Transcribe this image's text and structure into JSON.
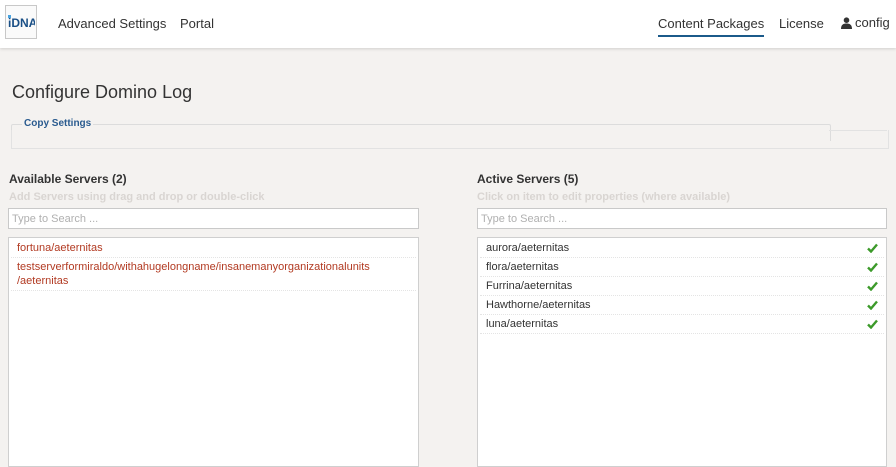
{
  "header": {
    "logo_text": "iDNA",
    "nav_left": [
      {
        "label": "Advanced Settings"
      },
      {
        "label": "Portal"
      }
    ],
    "nav_right": [
      {
        "label": "Content Packages",
        "active": true
      },
      {
        "label": "License"
      }
    ],
    "user": {
      "label": "config",
      "icon": "user-icon"
    }
  },
  "page": {
    "title": "Configure Domino Log",
    "fieldset_legend": "Copy Settings"
  },
  "available": {
    "title": "Available Servers (2)",
    "hint": "Add Servers using drag and drop or double-click",
    "search_placeholder": "Type to Search ...",
    "items": [
      {
        "label": "fortuna/aeternitas"
      },
      {
        "label": "testserverformiraldo/withahugelongname/insanemanyorganizationalunits /aeternitas"
      }
    ]
  },
  "active": {
    "title": "Active Servers (5)",
    "hint": "Click on item to edit properties (where available)",
    "search_placeholder": "Type to Search ...",
    "check_icon": "check-icon",
    "check_color": "#3c9a2a",
    "items": [
      {
        "label": "aurora/aeternitas"
      },
      {
        "label": "flora/aeternitas"
      },
      {
        "label": "Furrina/aeternitas"
      },
      {
        "label": "Hawthorne/aeternitas"
      },
      {
        "label": "luna/aeternitas"
      }
    ]
  }
}
